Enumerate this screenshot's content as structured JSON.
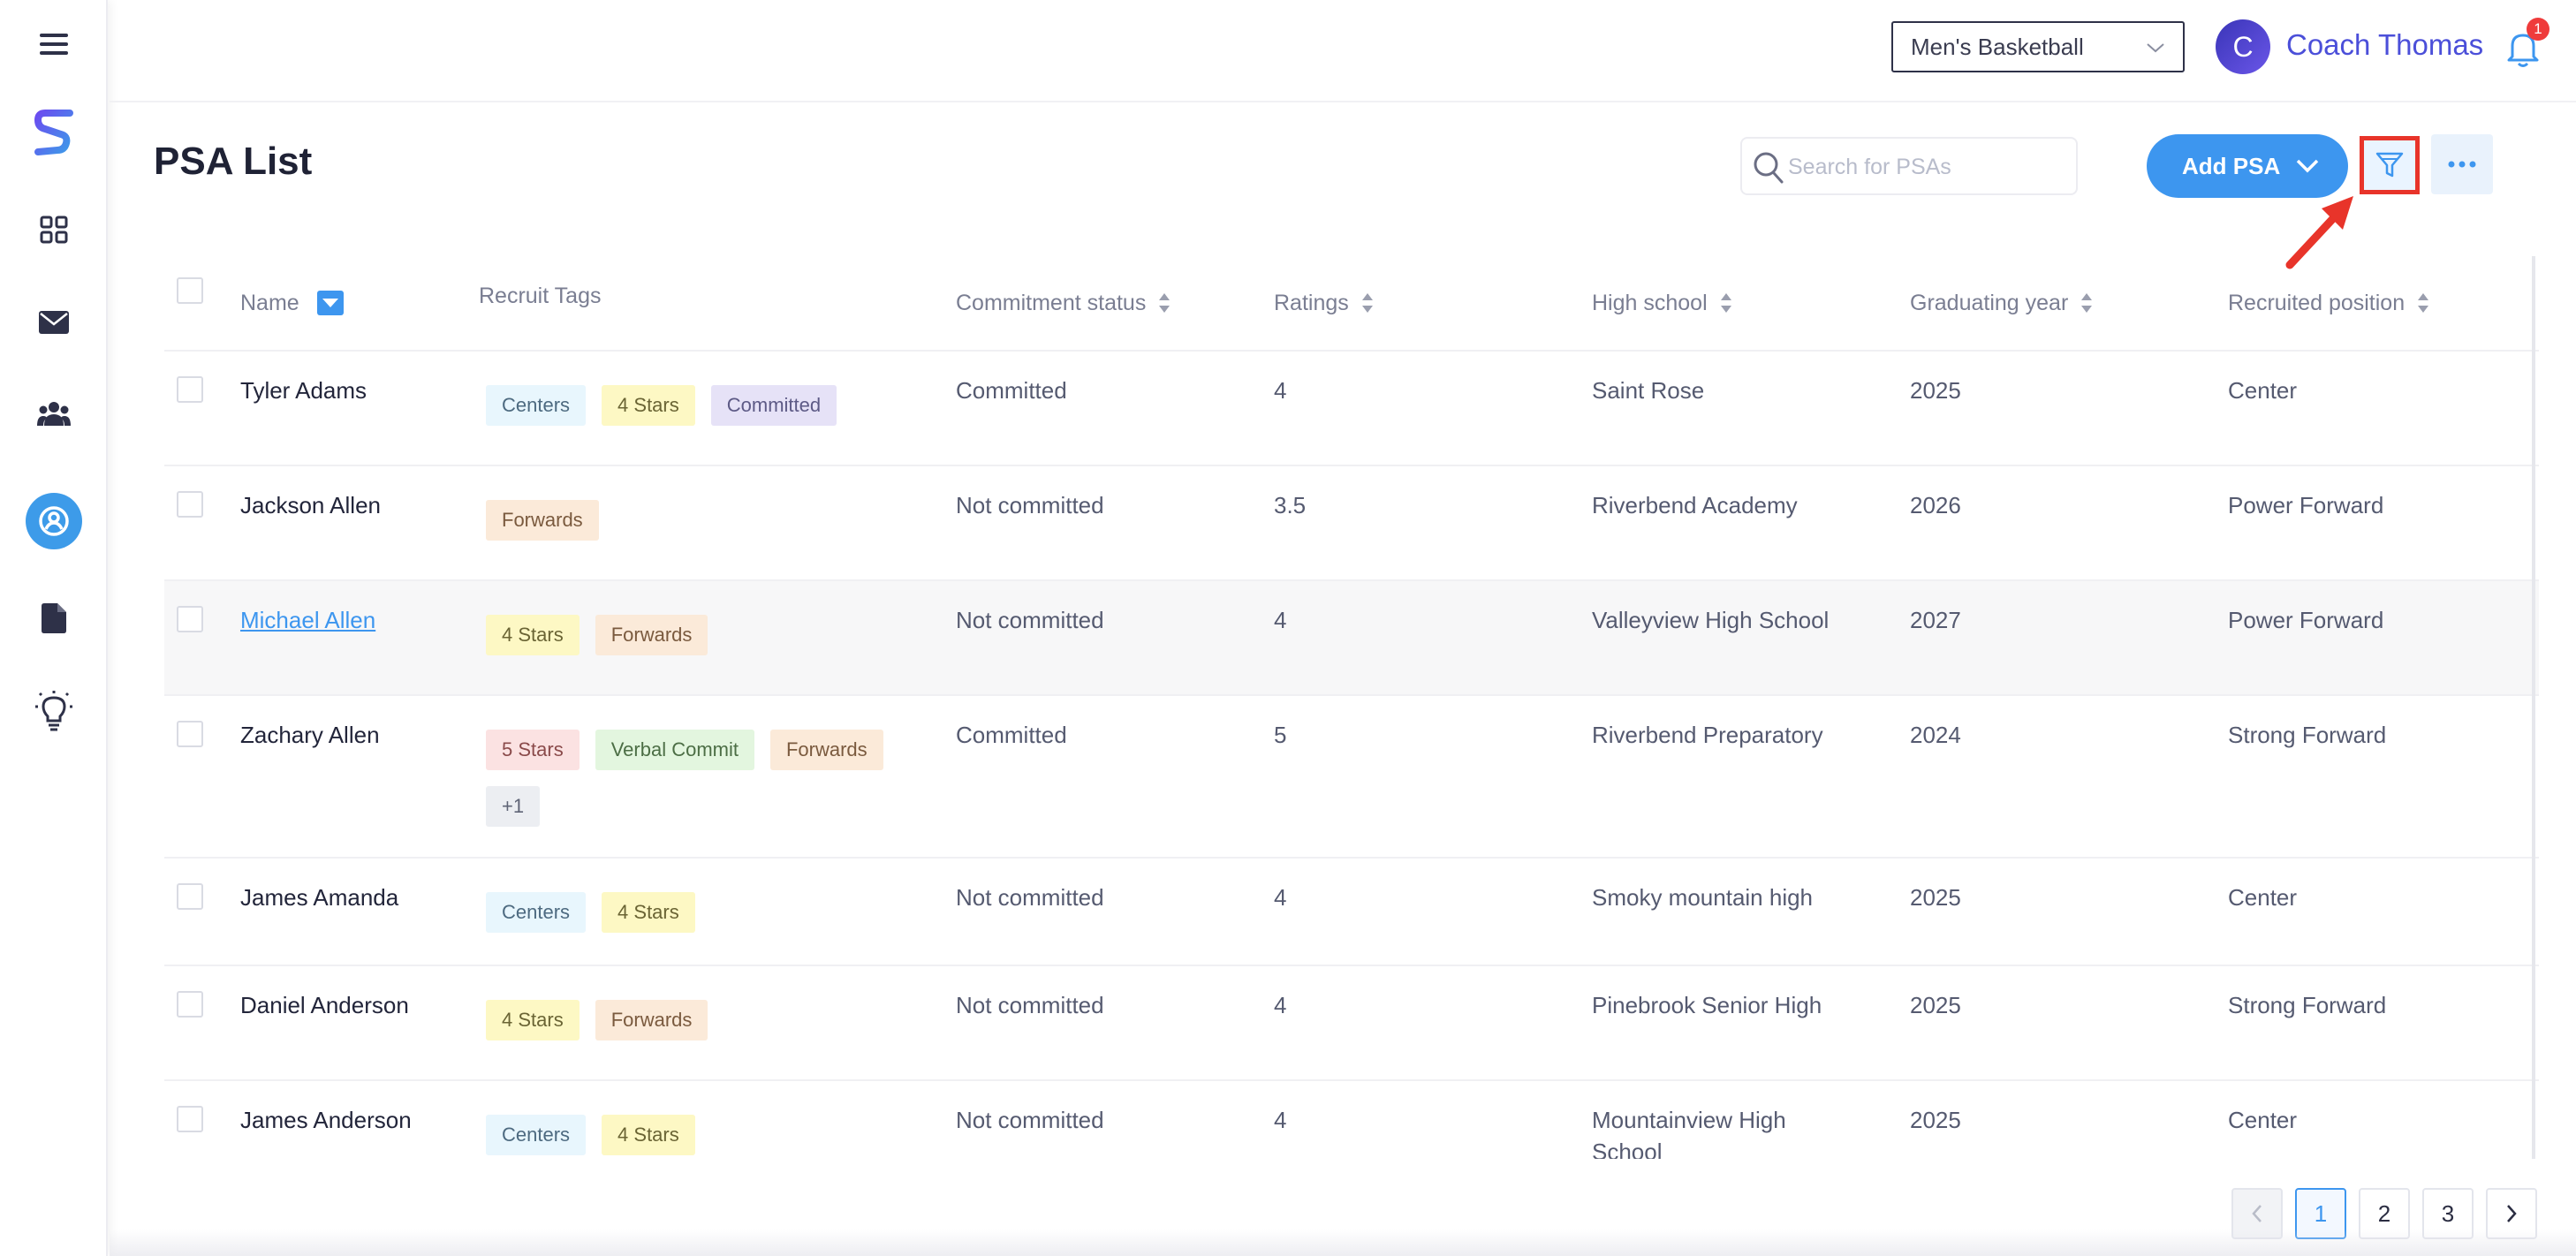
{
  "sidebar": {
    "items": [
      {
        "icon": "hamburger-menu-icon"
      },
      {
        "icon": "app-logo-icon"
      },
      {
        "icon": "dashboard-grid-icon"
      },
      {
        "icon": "mail-icon"
      },
      {
        "icon": "team-icon"
      },
      {
        "icon": "recruit-search-icon",
        "active": true
      },
      {
        "icon": "document-icon"
      },
      {
        "icon": "lightbulb-icon"
      }
    ]
  },
  "header": {
    "sport_selected": "Men's Basketball",
    "avatar_initial": "C",
    "user_name": "Coach Thomas",
    "notification_count": "1"
  },
  "page": {
    "title": "PSA List",
    "search_placeholder": "Search for PSAs",
    "add_label": "Add PSA"
  },
  "table": {
    "columns": {
      "name": "Name",
      "tags": "Recruit Tags",
      "commitment": "Commitment status",
      "ratings": "Ratings",
      "school": "High school",
      "year": "Graduating year",
      "position": "Recruited position"
    },
    "rows": [
      {
        "name": "Tyler Adams",
        "tags": [
          {
            "label": "Centers",
            "kind": "centers"
          },
          {
            "label": "4 Stars",
            "kind": "stars4"
          },
          {
            "label": "Committed",
            "kind": "committed"
          }
        ],
        "commitment": "Committed",
        "rating": "4",
        "school": "Saint Rose",
        "year": "2025",
        "position": "Center"
      },
      {
        "name": "Jackson Allen",
        "tags": [
          {
            "label": "Forwards",
            "kind": "forwards"
          }
        ],
        "commitment": "Not committed",
        "rating": "3.5",
        "school": "Riverbend Academy",
        "year": "2026",
        "position": "Power Forward"
      },
      {
        "name": "Michael Allen",
        "link": true,
        "highlight": true,
        "tags": [
          {
            "label": "4 Stars",
            "kind": "stars4"
          },
          {
            "label": "Forwards",
            "kind": "forwards"
          }
        ],
        "commitment": "Not committed",
        "rating": "4",
        "school": "Valleyview High School",
        "year": "2027",
        "position": "Power Forward"
      },
      {
        "name": "Zachary Allen",
        "tags": [
          {
            "label": "5 Stars",
            "kind": "stars5"
          },
          {
            "label": "Verbal Commit",
            "kind": "verbal"
          },
          {
            "label": "Forwards",
            "kind": "forwards"
          },
          {
            "label": "+1",
            "kind": "more"
          }
        ],
        "commitment": "Committed",
        "rating": "5",
        "school": "Riverbend Preparatory",
        "year": "2024",
        "position": "Strong Forward"
      },
      {
        "name": "James Amanda",
        "tags": [
          {
            "label": "Centers",
            "kind": "centers"
          },
          {
            "label": "4 Stars",
            "kind": "stars4"
          }
        ],
        "commitment": "Not committed",
        "rating": "4",
        "school": "Smoky mountain high",
        "year": "2025",
        "position": "Center"
      },
      {
        "name": "Daniel Anderson",
        "tags": [
          {
            "label": "4 Stars",
            "kind": "stars4"
          },
          {
            "label": "Forwards",
            "kind": "forwards"
          }
        ],
        "commitment": "Not committed",
        "rating": "4",
        "school": "Pinebrook Senior High",
        "year": "2025",
        "position": "Strong Forward"
      },
      {
        "name": "James Anderson",
        "tags": [
          {
            "label": "Centers",
            "kind": "centers"
          },
          {
            "label": "4 Stars",
            "kind": "stars4"
          }
        ],
        "commitment": "Not committed",
        "rating": "4",
        "school": "Mountainview High School",
        "year": "2025",
        "position": "Center"
      }
    ]
  },
  "tag_colors": {
    "centers": {
      "bg": "#e8f6fd",
      "fg": "#4d6a80"
    },
    "stars4": {
      "bg": "#fdf8c4",
      "fg": "#6a6434"
    },
    "committed": {
      "bg": "#e6e2f7",
      "fg": "#5d5a86"
    },
    "forwards": {
      "bg": "#fbead9",
      "fg": "#7a5a3e"
    },
    "stars5": {
      "bg": "#fbe2e2",
      "fg": "#8a4a4a"
    },
    "verbal": {
      "bg": "#e3f6df",
      "fg": "#4c6e45"
    },
    "more": {
      "bg": "#eceef2",
      "fg": "#5f6476"
    }
  },
  "pagination": {
    "pages": [
      "1",
      "2",
      "3"
    ],
    "current": "1"
  },
  "colors": {
    "accent": "#3d96ef",
    "annotation": "#e8342a"
  }
}
